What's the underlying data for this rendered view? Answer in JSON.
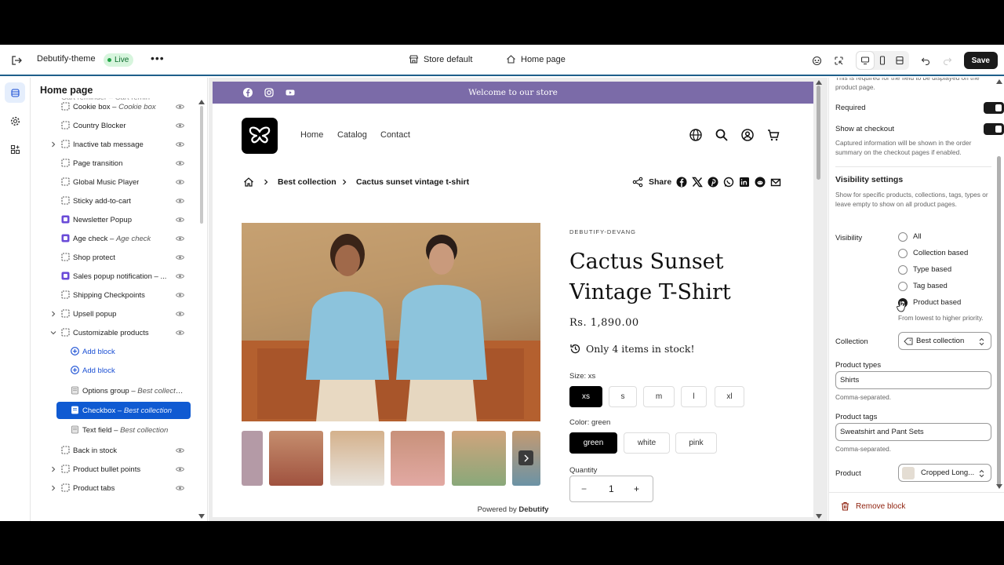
{
  "topbar": {
    "theme_name": "Debutify-theme",
    "live_badge": "Live",
    "more": "•••",
    "store_label": "Store default",
    "page_label": "Home page",
    "save_label": "Save"
  },
  "sidebar": {
    "title": "Home page",
    "items": [
      {
        "label": "Cookie box",
        "sub": "Cookie box"
      },
      {
        "label": "Country Blocker",
        "sub": ""
      },
      {
        "label": "Inactive tab message",
        "sub": ""
      },
      {
        "label": "Page transition",
        "sub": ""
      },
      {
        "label": "Global Music Player",
        "sub": ""
      },
      {
        "label": "Sticky add-to-cart",
        "sub": ""
      },
      {
        "label": "Newsletter Popup",
        "sub": ""
      },
      {
        "label": "Age check",
        "sub": "Age check"
      },
      {
        "label": "Shop protect",
        "sub": ""
      },
      {
        "label": "Sales popup notification – ...",
        "sub": ""
      },
      {
        "label": "Shipping Checkpoints",
        "sub": ""
      },
      {
        "label": "Upsell popup",
        "sub": ""
      },
      {
        "label": "Customizable products",
        "sub": ""
      },
      {
        "label": "Add block",
        "sub": ""
      },
      {
        "label": "Add block",
        "sub": ""
      },
      {
        "label": "Options group",
        "sub": "Best collection"
      },
      {
        "label": "Checkbox",
        "sub": "Best collection"
      },
      {
        "label": "Text field",
        "sub": "Best collection"
      },
      {
        "label": "Back in stock",
        "sub": ""
      },
      {
        "label": "Product bullet points",
        "sub": ""
      },
      {
        "label": "Product tabs",
        "sub": ""
      }
    ]
  },
  "store": {
    "announcement": "Welcome to our store",
    "nav": [
      "Home",
      "Catalog",
      "Contact"
    ],
    "breadcrumb": [
      "Best collection",
      "Cactus sunset vintage t-shirt"
    ],
    "share_label": "Share",
    "vendor": "DEBUTIFY-DEVANG",
    "title_line1": "Cactus Sunset",
    "title_line2": "Vintage T-Shirt",
    "price": "Rs. 1,890.00",
    "stock": "Only 4 items in stock!",
    "size_label": "Size: xs",
    "sizes": [
      "xs",
      "s",
      "m",
      "l",
      "xl"
    ],
    "color_label": "Color: green",
    "colors": [
      "green",
      "white",
      "pink"
    ],
    "quantity_label": "Quantity",
    "quantity": "1",
    "qty_minus": "−",
    "qty_plus": "+",
    "powered_prefix": "Powered by",
    "powered_brand": "Debutify"
  },
  "panel": {
    "required_note": "This is required for the field to be displayed on the product page.",
    "required_label": "Required",
    "show_checkout_label": "Show at checkout",
    "checkout_note": "Captured information will be shown in the order summary on the checkout pages if enabled.",
    "visibility_heading": "Visibility settings",
    "visibility_note": "Show for specific products, collections, tags, types or leave empty to show on all product pages.",
    "visibility_label": "Visibility",
    "visibility_options": [
      "All",
      "Collection based",
      "Type based",
      "Tag based",
      "Product based"
    ],
    "visibility_selected": "Product based",
    "priority_note": "From lowest to higher priority.",
    "collection_label": "Collection",
    "collection_value": "Best collection",
    "types_label": "Product types",
    "types_value": "Shirts",
    "types_note": "Comma-separated.",
    "tags_label": "Product tags",
    "tags_value": "Sweatshirt and Pant Sets",
    "tags_note": "Comma-separated.",
    "product_label": "Product",
    "product_value": "Cropped Long...",
    "remove_label": "Remove block"
  },
  "colors": {
    "announcement_bg": "#7b6ba8",
    "selected_item": "#0f5ad2",
    "live_badge_bg": "#d7f5dd",
    "remove_text": "#8e1f0b"
  }
}
